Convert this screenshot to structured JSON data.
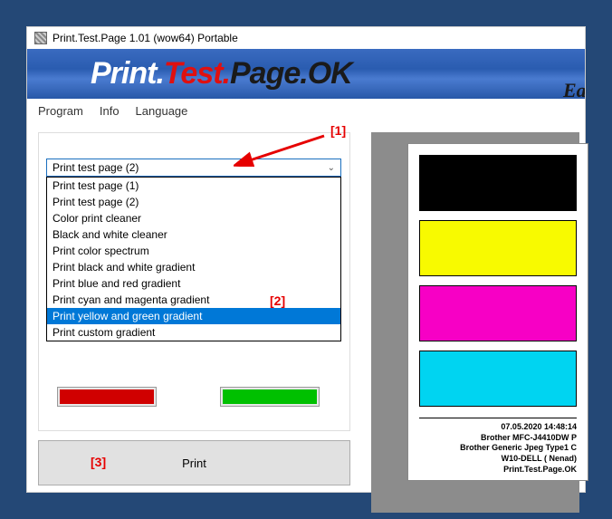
{
  "title": "Print.Test.Page 1.01  (wow64) Portable",
  "banner": {
    "p1": "Print.",
    "p2": "Test.",
    "p3": "Page.",
    "p4": "OK",
    "easy": "Easy"
  },
  "menu": {
    "program": "Program",
    "info": "Info",
    "language": "Language"
  },
  "combo": {
    "selected": "Print test page (2)"
  },
  "dropdown_items": [
    "Print test page (1)",
    "Print test page (2)",
    "Color print cleaner",
    "Black and white cleaner",
    "Print color spectrum",
    "Print black and white gradient",
    "Print blue and red gradient",
    "Print cyan and magenta gradient",
    "Print yellow and green gradient",
    "Print custom gradient"
  ],
  "highlighted_index": 8,
  "print_button": "Print",
  "annotations": {
    "a1": "[1]",
    "a2": "[2]",
    "a3": "[3]"
  },
  "page_info": {
    "l1": "07.05.2020  14:48:14",
    "l2": "Brother MFC-J4410DW P",
    "l3": "Brother Generic Jpeg Type1 C",
    "l4": "W10-DELL ( Nenad)",
    "l5": "Print.Test.Page.OK"
  }
}
